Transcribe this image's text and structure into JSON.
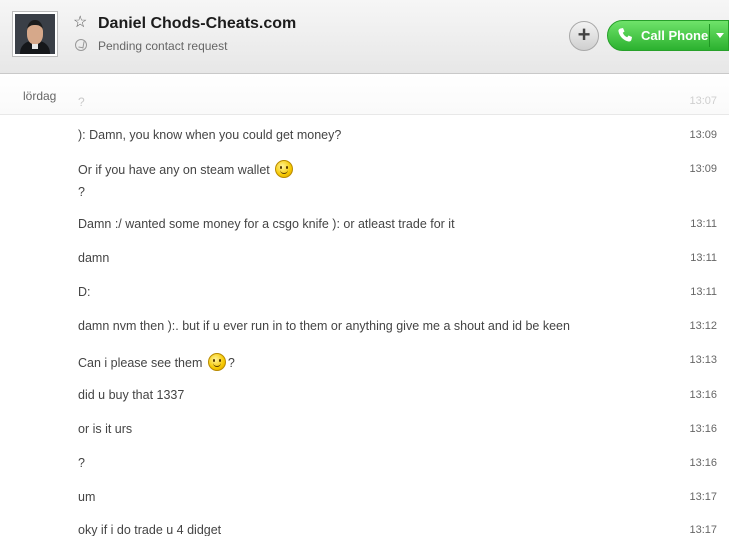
{
  "header": {
    "contact_name": "Daniel Chods-Cheats.com",
    "status": "Pending contact request",
    "call_label": "Call Phone",
    "add_label": "+"
  },
  "chat": {
    "date_label": "lördag",
    "faded_message": {
      "text": "?",
      "time": "13:07"
    },
    "messages": [
      {
        "text": "): Damn, you know when you could get money?",
        "time": "13:09"
      },
      {
        "text": "Or if you have any on steam wallet",
        "line2": "?",
        "time": "13:09"
      },
      {
        "text": "Damn :/ wanted some money for a csgo knife ):  or atleast trade for it",
        "time": "13:11"
      },
      {
        "text": "damn",
        "time": "13:11"
      },
      {
        "text": "D:",
        "time": "13:11"
      },
      {
        "text": "damn nvm then ):. but if u ever run in to them or anything give me a shout and id be keen",
        "time": "13:12"
      },
      {
        "text": "Can i please see them",
        "after": "?",
        "time": "13:13"
      },
      {
        "text": "did u buy that 1337",
        "time": "13:16"
      },
      {
        "text": "or is it urs",
        "time": "13:16"
      },
      {
        "text": "?",
        "time": "13:16"
      },
      {
        "text": "um",
        "time": "13:17"
      },
      {
        "text": "oky if i do trade u 4 didget",
        "time": "13:17"
      }
    ]
  },
  "colors": {
    "call_green": "#2bb12f",
    "text": "#444444"
  }
}
